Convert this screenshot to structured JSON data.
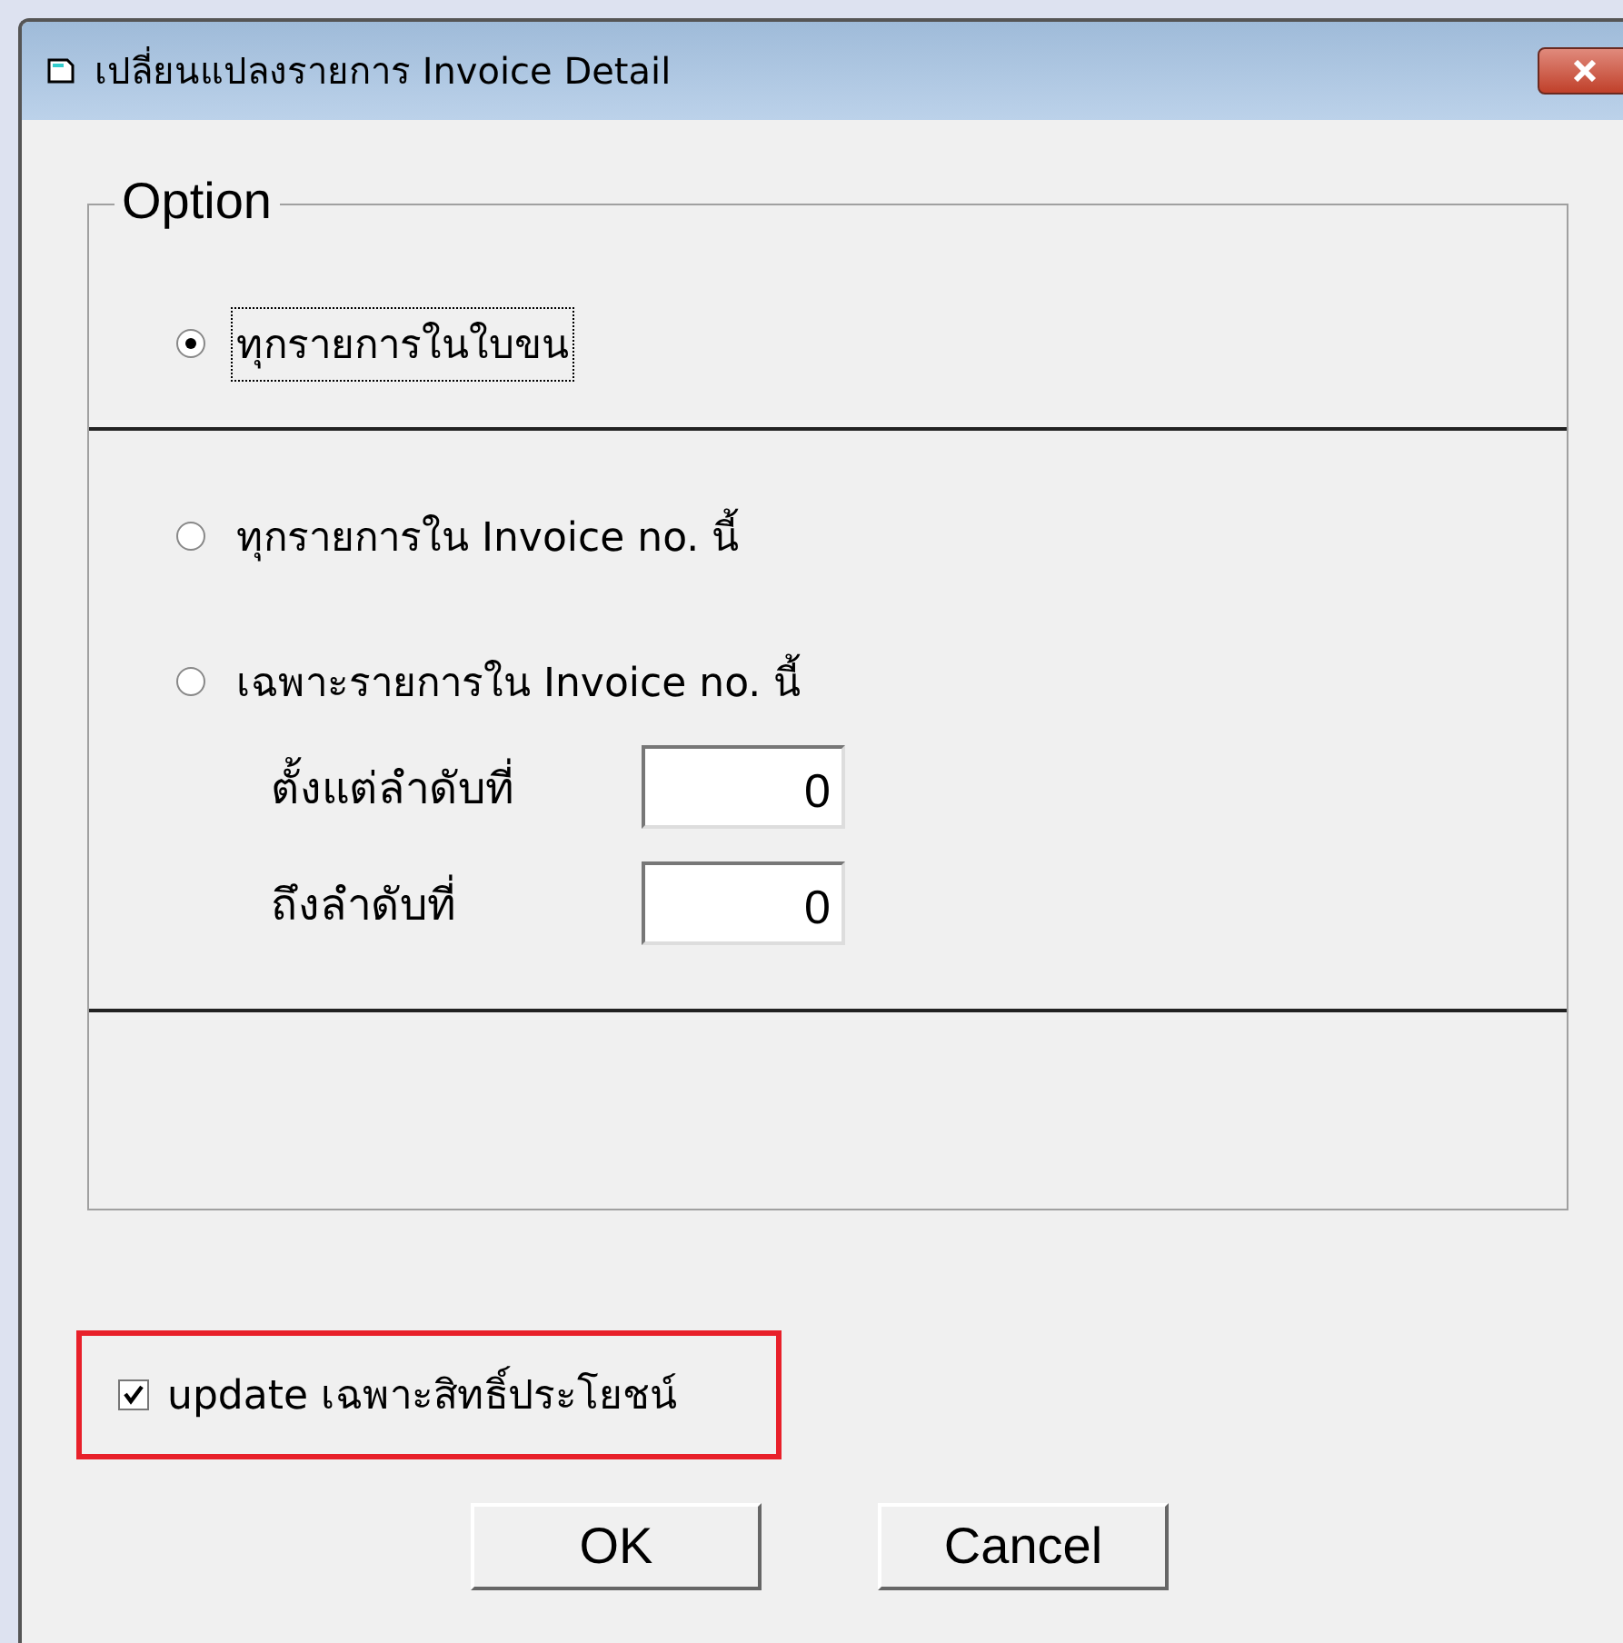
{
  "window": {
    "title": "เปลี่ยนแปลงรายการ Invoice Detail"
  },
  "group": {
    "title": "Option"
  },
  "options": [
    {
      "label": "ทุกรายการในใบขน",
      "selected": true,
      "focused": true
    },
    {
      "label": "ทุกรายการใน Invoice no. นี้",
      "selected": false,
      "focused": false
    },
    {
      "label": "เฉพาะรายการใน Invoice no. นี้",
      "selected": false,
      "focused": false
    }
  ],
  "range_fields": [
    {
      "label": "ตั้งแต่ลำดับที่",
      "value": "0"
    },
    {
      "label": "ถึงลำดับที่",
      "value": "0"
    }
  ],
  "checkbox": {
    "label": "update เฉพาะสิทธิ์ประโยชน์",
    "checked": true
  },
  "buttons": [
    "OK",
    "Cancel"
  ]
}
